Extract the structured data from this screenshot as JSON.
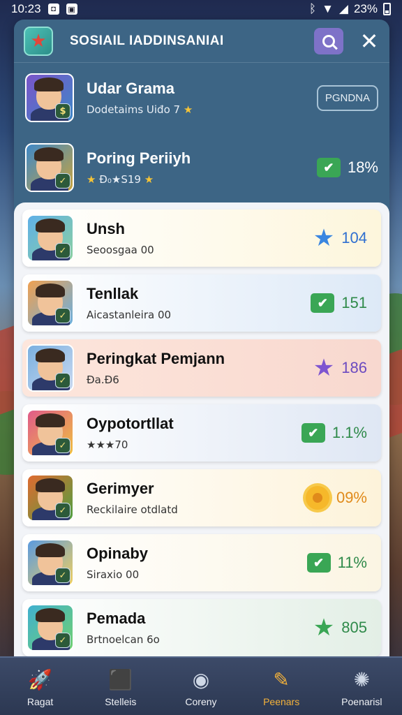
{
  "status_bar": {
    "time": "10:23",
    "battery": "23%"
  },
  "header": {
    "title": "SOSIAIL IADDINSANIAI"
  },
  "top_players": [
    {
      "name": "Udar Grama",
      "subtitle": "Dodetaims Uiđo 7",
      "action_label": "PGNDNA"
    },
    {
      "name": "Poring Periiyh",
      "subtitle": "Đ₀★S19",
      "stat": "18%",
      "stat_icon": "check-icon"
    }
  ],
  "players": [
    {
      "name": "Unsh",
      "subtitle": "Seoosgaa 00",
      "stat": "104",
      "stat_icon": "star-icon",
      "stat_color": "#2f6fd0",
      "icon_color": "#3a86e0",
      "card_bg": "linear-gradient(90deg,#ffffff,#fdf6dc)"
    },
    {
      "name": "Tenllak",
      "subtitle": "Aicastanleira 00",
      "stat": "151",
      "stat_icon": "check-icon",
      "stat_color": "#2f8a4a",
      "icon_color": "#3aa655",
      "card_bg": "linear-gradient(90deg,#ffffff,#dde9f7)"
    },
    {
      "name": "Peringkat Pemjann",
      "subtitle": "Đa.Đ6",
      "stat": "186",
      "stat_icon": "star-icon",
      "stat_color": "#6b4ac0",
      "icon_color": "#7e55d0",
      "card_bg": "linear-gradient(90deg,#fde6dc,#f8d8cf)"
    },
    {
      "name": "Oypotortllat",
      "subtitle": "★★★70",
      "stat": "1.1%",
      "stat_icon": "check-icon",
      "stat_color": "#2f8a4a",
      "icon_color": "#3aa655",
      "card_bg": "linear-gradient(90deg,#ffffff,#dfe7f4)"
    },
    {
      "name": "Gerimyer",
      "subtitle": "Reckilaire otdlatd",
      "stat": "09%",
      "stat_icon": "gear-icon",
      "stat_color": "#e08a1a",
      "icon_color": "#f6b82a",
      "card_bg": "linear-gradient(90deg,#ffffff,#fdf3da)"
    },
    {
      "name": "Opinaby",
      "subtitle": "Siraxio 00",
      "stat": "11%",
      "stat_icon": "check-icon",
      "stat_color": "#2f8a4a",
      "icon_color": "#3aa655",
      "card_bg": "linear-gradient(90deg,#ffffff,#fbf5e3)"
    },
    {
      "name": "Pemada",
      "subtitle": "Brtnoelcan 6o",
      "stat": "805",
      "stat_icon": "star-icon",
      "stat_color": "#2f8a4a",
      "icon_color": "#3aa655",
      "card_bg": "linear-gradient(90deg,#ffffff,#e3efe6)"
    }
  ],
  "bottom_nav": [
    {
      "label": "Ragat",
      "icon": "rocket-icon",
      "glyph": "🚀",
      "active": false
    },
    {
      "label": "Stelleis",
      "icon": "cube-icon",
      "glyph": "⬛",
      "active": false
    },
    {
      "label": "Coreny",
      "icon": "orb-icon",
      "glyph": "◉",
      "active": false
    },
    {
      "label": "Peenars",
      "icon": "feather-icon",
      "glyph": "✎",
      "active": true
    },
    {
      "label": "Poenarisl",
      "icon": "badge-icon",
      "glyph": "✺",
      "active": false
    }
  ]
}
